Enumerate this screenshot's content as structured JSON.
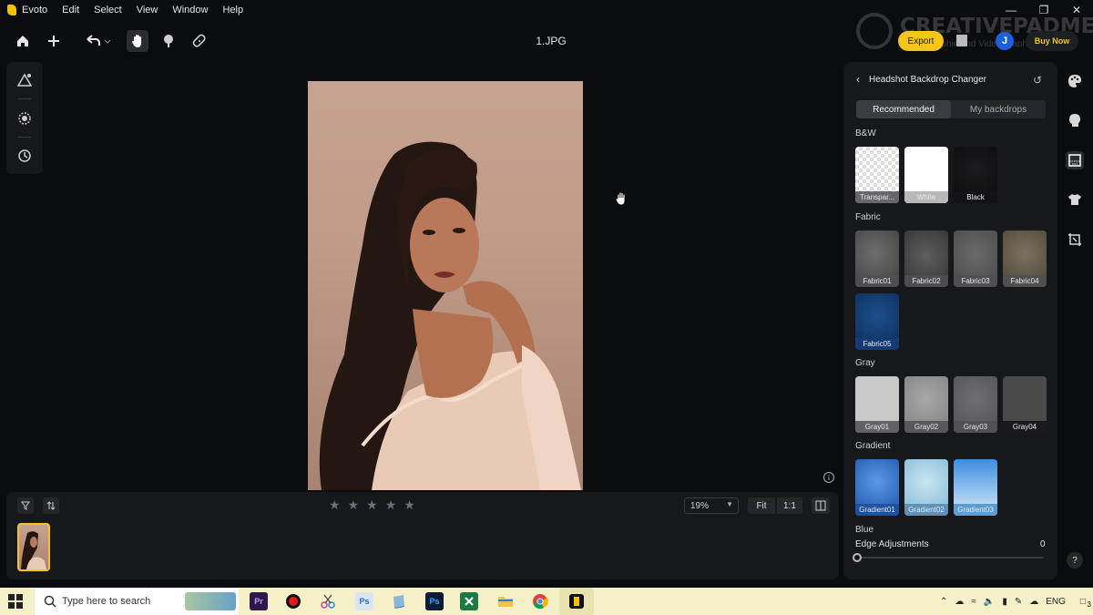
{
  "app": {
    "name": "Evoto",
    "menu": [
      "Edit",
      "Select",
      "View",
      "Window",
      "Help"
    ],
    "file_name": "1.JPG"
  },
  "topbar": {
    "export_label": "Export",
    "buy_label": "Buy Now",
    "avatar_initial": "J",
    "watermark_text": "CREATIVEPADMEDIA",
    "watermark_sub": "aphic and Video graphics"
  },
  "panel": {
    "title": "Headshot Backdrop Changer",
    "tabs": [
      "Recommended",
      "My backdrops"
    ],
    "sections": {
      "bw": "B&W",
      "fabric": "Fabric",
      "gray": "Gray",
      "gradient": "Gradient",
      "blue": "Blue"
    },
    "bw_items": [
      "Transpar...",
      "White",
      "Black"
    ],
    "fabric_items": [
      "Fabric01",
      "Fabric02",
      "Fabric03",
      "Fabric04",
      "Fabric05"
    ],
    "gray_items": [
      "Gray01",
      "Gray02",
      "Gray03",
      "Gray04"
    ],
    "gradient_items": [
      "Gradient01",
      "Gradient02",
      "Gradient03"
    ],
    "edge_label": "Edge Adjustments",
    "edge_value": "0"
  },
  "bottom": {
    "zoom": "19%",
    "fit": "Fit",
    "one_to_one": "1:1",
    "rating_stars": 5,
    "rating_value": 0
  },
  "taskbar": {
    "search_placeholder": "Type here to search",
    "language": "ENG",
    "notification_count": "3",
    "apps": [
      "Pr",
      "Ps",
      "Ps"
    ]
  },
  "colors": {
    "accent": "#f5c518",
    "selected": "#2e6bd8",
    "panel_bg": "#17181c"
  }
}
